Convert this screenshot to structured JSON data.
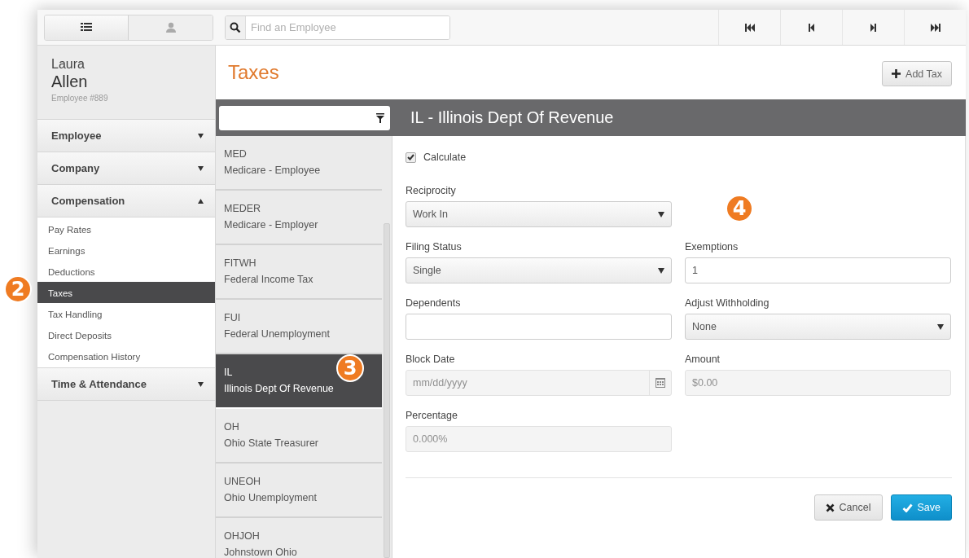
{
  "toolbar": {
    "view_toggle": [
      {
        "kind": "list",
        "selected": true
      },
      {
        "kind": "person",
        "selected": false
      }
    ],
    "search": {
      "placeholder": "Find an Employee"
    }
  },
  "employee": {
    "first_name": "Laura",
    "last_name": "Allen",
    "number": "Employee #889"
  },
  "sidebar": {
    "sections": [
      {
        "label": "Employee",
        "expanded": false
      },
      {
        "label": "Company",
        "expanded": false
      },
      {
        "label": "Compensation",
        "expanded": true,
        "items": [
          {
            "label": "Pay Rates",
            "selected": false
          },
          {
            "label": "Earnings",
            "selected": false
          },
          {
            "label": "Deductions",
            "selected": false
          },
          {
            "label": "Taxes",
            "selected": true
          },
          {
            "label": "Tax Handling",
            "selected": false
          },
          {
            "label": "Direct Deposits",
            "selected": false
          },
          {
            "label": "Compensation History",
            "selected": false
          }
        ]
      },
      {
        "label": "Time & Attendance",
        "expanded": false
      }
    ]
  },
  "page_title": "Taxes",
  "add_button": "Add Tax",
  "tax_list": [
    {
      "code": "MED",
      "name": "Medicare - Employee",
      "selected": false
    },
    {
      "code": "MEDER",
      "name": "Medicare - Employer",
      "selected": false
    },
    {
      "code": "FITWH",
      "name": "Federal Income Tax",
      "selected": false
    },
    {
      "code": "FUI",
      "name": "Federal Unemployment",
      "selected": false
    },
    {
      "code": "IL",
      "name": "Illinois Dept Of Revenue",
      "selected": true
    },
    {
      "code": "OH",
      "name": "Ohio State Treasurer",
      "selected": false
    },
    {
      "code": "UNEOH",
      "name": "Ohio Unemployment",
      "selected": false
    },
    {
      "code": "OHJOH",
      "name": "Johnstown Ohio",
      "selected": false
    }
  ],
  "form": {
    "title": "IL - Illinois Dept Of Revenue",
    "calculate": {
      "label": "Calculate",
      "checked": true
    },
    "rows": [
      [
        {
          "label": "Reciprocity",
          "kind": "select",
          "value": "Work In",
          "disabled": false
        }
      ],
      [
        {
          "label": "Filing Status",
          "kind": "select",
          "value": "Single",
          "disabled": false
        },
        {
          "label": "Exemptions",
          "kind": "text",
          "value": "1",
          "disabled": false
        }
      ],
      [
        {
          "label": "Dependents",
          "kind": "text",
          "disabled": false
        },
        {
          "label": "Adjust Withholding",
          "kind": "select",
          "value": "None",
          "disabled": false
        }
      ],
      [
        {
          "label": "Block Date",
          "kind": "date",
          "placeholder": "mm/dd/yyyy",
          "disabled": true
        },
        {
          "label": "Amount",
          "kind": "text",
          "placeholder": "$0.00",
          "disabled": true
        }
      ],
      [
        {
          "label": "Percentage",
          "kind": "text",
          "placeholder": "0.000%",
          "disabled": true
        }
      ]
    ],
    "cancel": "Cancel",
    "save": "Save"
  },
  "callouts": [
    "2",
    "3",
    "4"
  ]
}
